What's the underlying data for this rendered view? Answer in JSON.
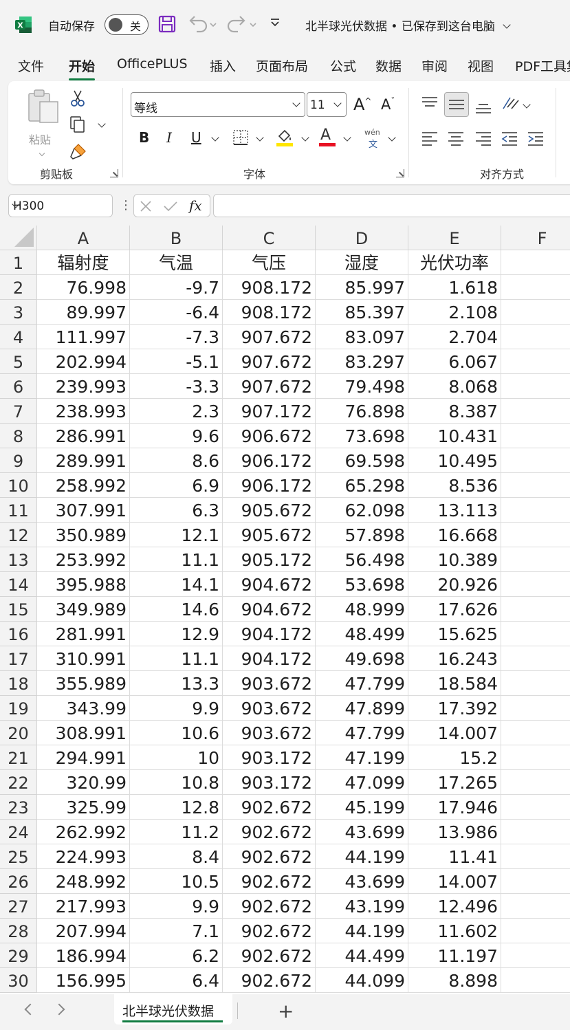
{
  "titlebar": {
    "autosave_label": "自动保存",
    "autosave_state": "关",
    "document_title": "北半球光伏数据 • 已保存到这台电脑",
    "app_icon_letter": "X"
  },
  "tabs": [
    "文件",
    "开始",
    "OfficePLUS",
    "插入",
    "页面布局",
    "公式",
    "数据",
    "审阅",
    "视图",
    "PDF工具集"
  ],
  "active_tab": "开始",
  "ribbon": {
    "clipboard": {
      "group_label": "剪贴板",
      "paste_label": "粘贴"
    },
    "font": {
      "group_label": "字体",
      "font_name": "等线",
      "font_size": "11",
      "bold": "B",
      "italic": "I",
      "underline": "U",
      "font_color_glyph": "A",
      "phonetic_top": "wén",
      "phonetic_bottom": "文",
      "grow_glyph": "A",
      "shrink_glyph": "A"
    },
    "alignment": {
      "group_label": "对齐方式"
    },
    "colors": {
      "highlight": "#ffe600",
      "font_color": "#e81123",
      "accent": "#107c41"
    }
  },
  "formula_bar": {
    "name_box": "H300",
    "formula": "",
    "fx": "fx"
  },
  "grid": {
    "columns": [
      "A",
      "B",
      "C",
      "D",
      "E",
      "F"
    ],
    "headers": [
      "辐射度",
      "气温",
      "气压",
      "湿度",
      "光伏功率"
    ],
    "rows": [
      [
        "76.998",
        "-9.7",
        "908.172",
        "85.997",
        "1.618"
      ],
      [
        "89.997",
        "-6.4",
        "908.172",
        "85.397",
        "2.108"
      ],
      [
        "111.997",
        "-7.3",
        "907.672",
        "83.097",
        "2.704"
      ],
      [
        "202.994",
        "-5.1",
        "907.672",
        "83.297",
        "6.067"
      ],
      [
        "239.993",
        "-3.3",
        "907.672",
        "79.498",
        "8.068"
      ],
      [
        "238.993",
        "2.3",
        "907.172",
        "76.898",
        "8.387"
      ],
      [
        "286.991",
        "9.6",
        "906.672",
        "73.698",
        "10.431"
      ],
      [
        "289.991",
        "8.6",
        "906.172",
        "69.598",
        "10.495"
      ],
      [
        "258.992",
        "6.9",
        "906.172",
        "65.298",
        "8.536"
      ],
      [
        "307.991",
        "6.3",
        "905.672",
        "62.098",
        "13.113"
      ],
      [
        "350.989",
        "12.1",
        "905.672",
        "57.898",
        "16.668"
      ],
      [
        "253.992",
        "11.1",
        "905.172",
        "56.498",
        "10.389"
      ],
      [
        "395.988",
        "14.1",
        "904.672",
        "53.698",
        "20.926"
      ],
      [
        "349.989",
        "14.6",
        "904.672",
        "48.999",
        "17.626"
      ],
      [
        "281.991",
        "12.9",
        "904.172",
        "48.499",
        "15.625"
      ],
      [
        "310.991",
        "11.1",
        "904.172",
        "49.698",
        "16.243"
      ],
      [
        "355.989",
        "13.3",
        "903.672",
        "47.799",
        "18.584"
      ],
      [
        "343.99",
        "9.9",
        "903.672",
        "47.899",
        "17.392"
      ],
      [
        "308.991",
        "10.6",
        "903.672",
        "47.799",
        "14.007"
      ],
      [
        "294.991",
        "10",
        "903.172",
        "47.199",
        "15.2"
      ],
      [
        "320.99",
        "10.8",
        "903.172",
        "47.099",
        "17.265"
      ],
      [
        "325.99",
        "12.8",
        "902.672",
        "45.199",
        "17.946"
      ],
      [
        "262.992",
        "11.2",
        "902.672",
        "43.699",
        "13.986"
      ],
      [
        "224.993",
        "8.4",
        "902.672",
        "44.199",
        "11.41"
      ],
      [
        "248.992",
        "10.5",
        "902.672",
        "43.699",
        "14.007"
      ],
      [
        "217.993",
        "9.9",
        "902.672",
        "43.199",
        "12.496"
      ],
      [
        "207.994",
        "7.1",
        "902.672",
        "44.199",
        "11.602"
      ],
      [
        "186.994",
        "6.2",
        "902.672",
        "44.499",
        "11.197"
      ],
      [
        "156.995",
        "6.4",
        "902.672",
        "44.099",
        "8.898"
      ]
    ]
  },
  "sheet_tabs": {
    "active": "北半球光伏数据",
    "add": "+"
  }
}
